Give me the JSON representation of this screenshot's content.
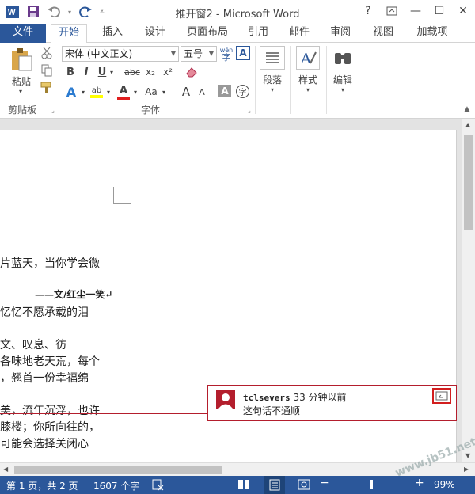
{
  "window": {
    "title": "推开窗2 - Microsoft Word"
  },
  "window_controls": {
    "help": "?",
    "ribbon_display": "⌅",
    "minimize": "—",
    "maximize": "☐",
    "close": "✕"
  },
  "tabs": [
    {
      "label": "文件"
    },
    {
      "label": "开始"
    },
    {
      "label": "插入"
    },
    {
      "label": "设计"
    },
    {
      "label": "页面布局"
    },
    {
      "label": "引用"
    },
    {
      "label": "邮件"
    },
    {
      "label": "审阅"
    },
    {
      "label": "视图"
    },
    {
      "label": "加载项"
    }
  ],
  "ribbon": {
    "clipboard": {
      "paste_label": "粘贴",
      "group_label": "剪贴板"
    },
    "font": {
      "name": "宋体 (中文正文)",
      "size": "五号",
      "wen_label": "wén",
      "group_label": "字体",
      "bold": "B",
      "italic": "I",
      "underline": "U",
      "strike": "abc",
      "subscript": "x₂",
      "superscript": "x²",
      "grow": "A",
      "shrink": "A",
      "case": "Aa",
      "font_color_glyph": "A",
      "highlight_glyph": "ab",
      "effects_glyph": "A",
      "char_shading": "A",
      "enclose": "字"
    },
    "paragraph": {
      "label": "段落"
    },
    "styles": {
      "label": "样式"
    },
    "editing": {
      "label": "编辑"
    }
  },
  "document": {
    "lines": [
      "片蓝天，当你学会微",
      "——文/红尘一笑↵",
      "忆忆不愿承载的泪",
      "文、叹息、彷",
      "各味地老天荒，每个",
      "，翘首一份幸福绵",
      "美，流年沉浮，也许",
      "膝楼；你所向往的，",
      "可能会选择关闭心"
    ]
  },
  "comment": {
    "author": "tclsevers",
    "time": "33 分钟以前",
    "text": "这句话不通顺"
  },
  "status": {
    "page": "第 1 页，共 2 页",
    "words": "1607 个字",
    "zoom": "99%",
    "zoom_minus": "−",
    "zoom_plus": "+"
  },
  "watermark": "www.jb51.net",
  "colors": {
    "accent": "#2b579a",
    "comment_border": "#b41e2d"
  }
}
